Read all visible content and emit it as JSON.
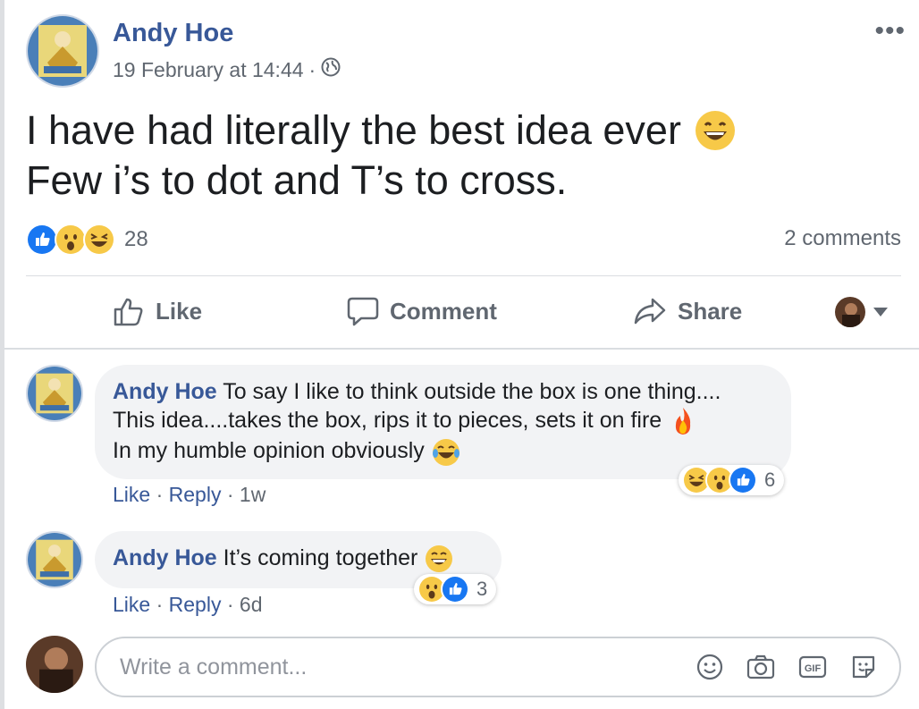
{
  "post": {
    "author": "Andy Hoe",
    "timestamp": "19 February at 14:44",
    "separator": "·",
    "privacy_icon": "globe-icon",
    "text_line1": "I have had literally the best idea ever",
    "text_line2": "Few i’s to dot and T’s to cross.",
    "reactions": [
      "like",
      "wow",
      "haha"
    ],
    "reaction_count": "28",
    "comments_count": "2 comments"
  },
  "actions": {
    "like": "Like",
    "comment": "Comment",
    "share": "Share"
  },
  "comments": [
    {
      "author": "Andy Hoe",
      "line1": "To say I like to think outside the box is one thing....",
      "line2": "This idea....takes the box, rips it to pieces, sets it on fire",
      "line3": "In my humble opinion obviously",
      "like": "Like",
      "reply": "Reply",
      "sep": "·",
      "time": "1w",
      "reactions": [
        "haha",
        "wow",
        "like"
      ],
      "reaction_count": "6"
    },
    {
      "author": "Andy Hoe",
      "text": "It’s coming together",
      "like": "Like",
      "reply": "Reply",
      "sep": "·",
      "time": "6d",
      "reactions": [
        "wow",
        "like"
      ],
      "reaction_count": "3"
    }
  ],
  "composer": {
    "placeholder": "Write a comment...",
    "icons": [
      "emoji-icon",
      "camera-icon",
      "gif-icon",
      "sticker-icon"
    ]
  },
  "colors": {
    "link": "#385898",
    "secondary_text": "#606770",
    "like_blue": "#1877f2",
    "emoji_yellow": "#f7c948"
  }
}
